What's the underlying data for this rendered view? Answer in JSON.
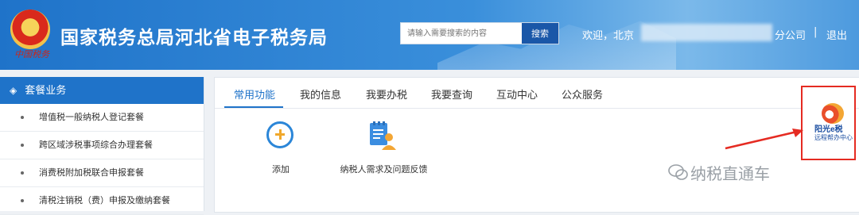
{
  "header": {
    "title": "国家税务总局河北省电子税务局",
    "emblem_text": "中国税务",
    "search_placeholder": "请输入需要搜索的内容",
    "search_button": "搜索",
    "welcome": "欢迎，北京",
    "branch": "分公司",
    "separator": "|",
    "logout": "退出"
  },
  "sidebar": {
    "heading": "套餐业务",
    "items": [
      {
        "label": "增值税一般纳税人登记套餐"
      },
      {
        "label": "跨区域涉税事项综合办理套餐"
      },
      {
        "label": "消费税附加税联合申报套餐"
      },
      {
        "label": "清税注销税（费）申报及缴纳套餐"
      }
    ]
  },
  "tabs": [
    {
      "label": "常用功能"
    },
    {
      "label": "我的信息"
    },
    {
      "label": "我要办税"
    },
    {
      "label": "我要查询"
    },
    {
      "label": "互动中心"
    },
    {
      "label": "公众服务"
    }
  ],
  "functions": [
    {
      "label": "添加"
    },
    {
      "label": "纳税人需求及问题反馈"
    }
  ],
  "promo": {
    "name": "阳光e税",
    "sub": "远程帮办中心"
  },
  "watermark": "纳税直通车",
  "colors": {
    "brand_blue": "#1f73c9",
    "highlight_red": "#e52b22",
    "add_orange": "#f0a82c"
  }
}
